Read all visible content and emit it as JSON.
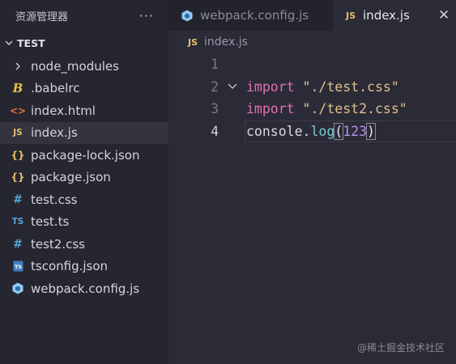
{
  "sidebar": {
    "title": "资源管理器",
    "more_label": "···",
    "section": "TEST",
    "items": [
      {
        "label": "node_modules",
        "icon": "chevron-right-icon"
      },
      {
        "label": ".babelrc",
        "icon": "babel-icon"
      },
      {
        "label": "index.html",
        "icon": "html-icon"
      },
      {
        "label": "index.js",
        "icon": "js-icon",
        "active": true
      },
      {
        "label": "package-lock.json",
        "icon": "json-icon"
      },
      {
        "label": "package.json",
        "icon": "json-icon"
      },
      {
        "label": "test.css",
        "icon": "css-icon"
      },
      {
        "label": "test.ts",
        "icon": "ts-icon"
      },
      {
        "label": "test2.css",
        "icon": "css-icon"
      },
      {
        "label": "tsconfig.json",
        "icon": "tsconfig-icon"
      },
      {
        "label": "webpack.config.js",
        "icon": "webpack-icon"
      }
    ]
  },
  "tabs": [
    {
      "label": "webpack.config.js",
      "icon": "webpack-icon"
    },
    {
      "label": "index.js",
      "icon": "js-icon",
      "close": "✕"
    }
  ],
  "icon_texts": {
    "js": "JS",
    "ts": "TS",
    "json": "{}",
    "css": "#",
    "html": "<>",
    "babel": "B"
  },
  "breadcrumb": {
    "badge": "JS",
    "file": "index.js"
  },
  "code": {
    "line_numbers": [
      "1",
      "2",
      "3",
      "4"
    ],
    "line2": {
      "kw": "import",
      "str": "\"./test.css\""
    },
    "line3": {
      "kw": "import",
      "str": "\"./test2.css\""
    },
    "line4": {
      "obj": "console",
      "dot": ".",
      "fn": "log",
      "open": "(",
      "num": "123",
      "close": ")"
    }
  },
  "watermark": "@稀土掘金技术社区",
  "colors": {
    "sidebar_bg": "#262631",
    "editor_bg": "#2b2b37",
    "keyword": "#e36fb3",
    "string": "#e2c08d",
    "function": "#77c7d1",
    "number": "#b48ef0",
    "js_badge": "#e5c069"
  }
}
